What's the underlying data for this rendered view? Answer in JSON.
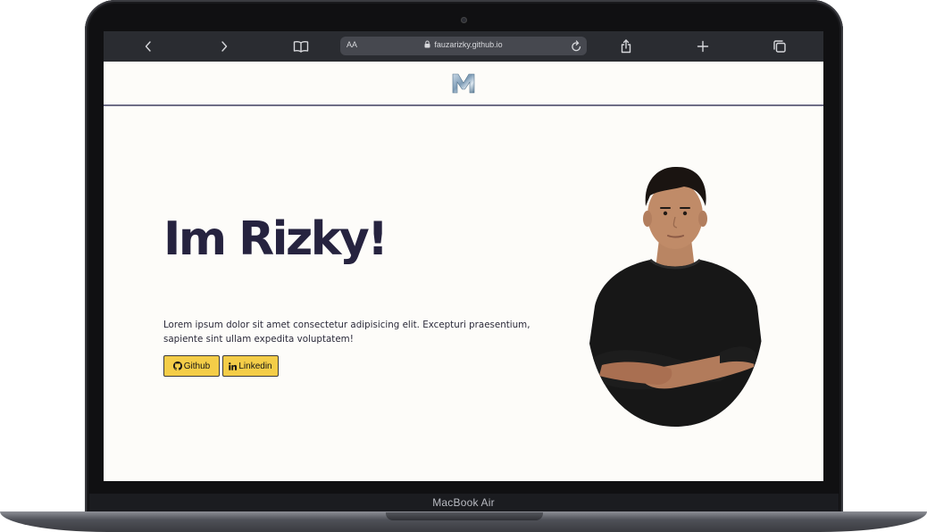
{
  "browser": {
    "text_size_label": "AA",
    "url": "fauzarizky.github.io"
  },
  "site": {
    "logo_letter": "M",
    "hero": {
      "title": "Im Rizky!",
      "description": "Lorem ipsum dolor sit amet consectetur adipisicing elit. Excepturi praesentium, sapiente sint ullam expedita voluptatem!"
    },
    "buttons": {
      "github": "Github",
      "linkedin": "Linkedin"
    }
  },
  "device": {
    "label": "MacBook Air"
  },
  "colors": {
    "title": "#26233f",
    "button": "#f4cd48",
    "toolbar": "#2a2c31",
    "page_background": "#fdfcf9"
  },
  "icons": {
    "back": "chevron-left-icon",
    "forward": "chevron-right-icon",
    "bookmarks": "book-icon",
    "lock": "lock-icon",
    "reload": "reload-icon",
    "share": "share-icon",
    "new_tab": "plus-icon",
    "tabs": "tabs-icon",
    "github": "github-icon",
    "linkedin": "linkedin-icon"
  }
}
